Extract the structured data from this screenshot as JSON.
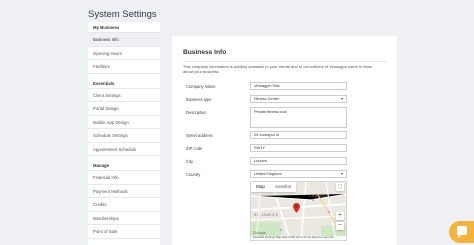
{
  "page": {
    "title": "System Settings"
  },
  "sidebar": {
    "sections": [
      {
        "header": "My Business",
        "items": [
          {
            "label": "Business Info",
            "active": true
          },
          {
            "label": "Opening Hours",
            "active": false
          },
          {
            "label": "Facilities",
            "active": false
          }
        ]
      },
      {
        "header": "Essentials",
        "items": [
          {
            "label": "Client Settings"
          },
          {
            "label": "Portal Design"
          },
          {
            "label": "Mobile App Design"
          },
          {
            "label": "Schedule Settings"
          },
          {
            "label": "Appointment Schedule"
          }
        ]
      },
      {
        "header": "Manage",
        "items": [
          {
            "label": "Financial Info"
          },
          {
            "label": "Payment Methods"
          },
          {
            "label": "Credits"
          },
          {
            "label": "Memberships"
          },
          {
            "label": "Point of Sale"
          }
        ]
      }
    ]
  },
  "main": {
    "title": "Business Info",
    "intro": "This company information is publicly available to your clients and to our millions of Virtuagym users to learn about your business.",
    "form": {
      "company_name": {
        "label": "Company Name",
        "value": "Virtuagym Test"
      },
      "business_type": {
        "label": "Business type",
        "value": "Fitness Center"
      },
      "description": {
        "label": "Description",
        "value": "Private fitness club"
      },
      "street_address": {
        "label": "Street address",
        "value": "25 cockspur st"
      },
      "zip_code": {
        "label": "ZIP code",
        "value": "SW1Y"
      },
      "city": {
        "label": "City",
        "value": "London"
      },
      "country": {
        "label": "Country",
        "value": "United Kingdom"
      }
    },
    "map": {
      "tab_map": "Map",
      "tab_satellite": "Satellite",
      "label_charing": "CHARING",
      "label_stjames": "ST. JAMES'S",
      "google": "Google",
      "attribution": "Keyboard shortcuts   Map data ©2024   Terms of Use   Report a map error",
      "pin_color": "#d93025"
    }
  },
  "colors": {
    "help_button": "#f3b43f"
  }
}
